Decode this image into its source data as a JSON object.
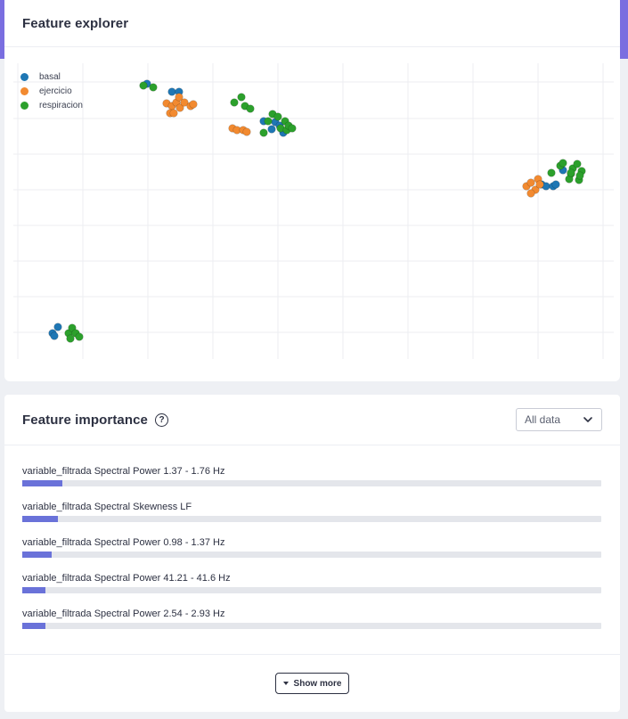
{
  "explorer": {
    "title": "Feature explorer"
  },
  "colors": {
    "accent": "#7a6ee0",
    "basal": "#1f77b4",
    "ejercicio": "#f28a30",
    "respiracion": "#2ca02c",
    "bar_fill": "#6a72d9"
  },
  "chart_data": {
    "type": "scatter",
    "title": "",
    "xlabel": "",
    "ylabel": "",
    "grid": true,
    "legend_position": "top-left",
    "series": [
      {
        "name": "basal",
        "color": "#1f77b4",
        "points": [
          [
            150,
            23
          ],
          [
            178,
            32
          ],
          [
            186,
            32
          ],
          [
            281,
            65
          ],
          [
            290,
            74
          ],
          [
            294,
            66
          ],
          [
            299,
            70
          ],
          [
            303,
            78
          ],
          [
            44,
            303
          ],
          [
            50,
            296
          ],
          [
            46,
            306
          ],
          [
            593,
            136
          ],
          [
            598,
            138
          ],
          [
            606,
            138
          ],
          [
            609,
            136
          ],
          [
            617,
            120
          ]
        ]
      },
      {
        "name": "ejercicio",
        "color": "#f28a30",
        "points": [
          [
            172,
            45
          ],
          [
            178,
            48
          ],
          [
            183,
            44
          ],
          [
            187,
            50
          ],
          [
            176,
            56
          ],
          [
            186,
            38
          ],
          [
            192,
            44
          ],
          [
            199,
            48
          ],
          [
            202,
            46
          ],
          [
            180,
            56
          ],
          [
            246,
            73
          ],
          [
            251,
            75
          ],
          [
            258,
            75
          ],
          [
            262,
            77
          ],
          [
            576,
            138
          ],
          [
            581,
            134
          ],
          [
            586,
            142
          ],
          [
            581,
            146
          ],
          [
            589,
            130
          ],
          [
            591,
            136
          ]
        ]
      },
      {
        "name": "respiracion",
        "color": "#2ca02c",
        "points": [
          [
            146,
            25
          ],
          [
            157,
            27
          ],
          [
            248,
            44
          ],
          [
            256,
            38
          ],
          [
            260,
            48
          ],
          [
            266,
            51
          ],
          [
            286,
            65
          ],
          [
            291,
            57
          ],
          [
            300,
            73
          ],
          [
            297,
            60
          ],
          [
            305,
            65
          ],
          [
            307,
            75
          ],
          [
            309,
            70
          ],
          [
            313,
            73
          ],
          [
            281,
            78
          ],
          [
            62,
            303
          ],
          [
            66,
            297
          ],
          [
            70,
            303
          ],
          [
            64,
            309
          ],
          [
            74,
            307
          ],
          [
            604,
            123
          ],
          [
            614,
            115
          ],
          [
            617,
            112
          ],
          [
            626,
            124
          ],
          [
            628,
            118
          ],
          [
            633,
            113
          ],
          [
            635,
            131
          ],
          [
            638,
            121
          ],
          [
            624,
            130
          ],
          [
            636,
            126
          ],
          [
            626,
            123
          ]
        ]
      }
    ],
    "xlim": [
      0,
      674
    ],
    "ylim": [
      332,
      0
    ]
  },
  "importance": {
    "title": "Feature importance",
    "help_icon": "question-circle-icon",
    "dropdown": {
      "selected": "All data",
      "icon": "chevron-down-icon"
    },
    "features": [
      {
        "label": "variable_filtrada Spectral Power 1.37 - 1.76 Hz",
        "value": 0.069
      },
      {
        "label": "variable_filtrada Spectral Skewness LF",
        "value": 0.061
      },
      {
        "label": "variable_filtrada Spectral Power 0.98 - 1.37 Hz",
        "value": 0.051
      },
      {
        "label": "variable_filtrada Spectral Power 41.21 - 41.6 Hz",
        "value": 0.04
      },
      {
        "label": "variable_filtrada Spectral Power 2.54 - 2.93 Hz",
        "value": 0.04
      }
    ],
    "show_more_label": "Show more",
    "show_more_icon": "caret-down-icon"
  }
}
